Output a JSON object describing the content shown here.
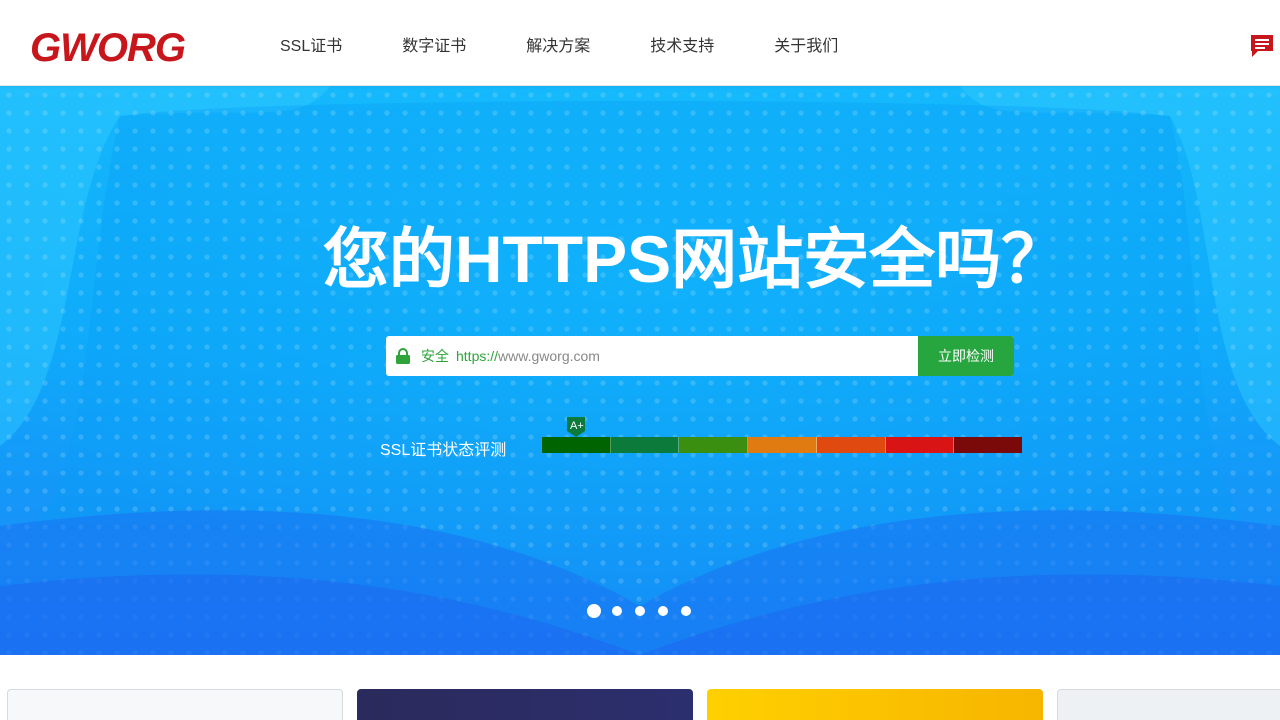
{
  "brand": {
    "logo_text": "GWORG",
    "color": "#c8161d"
  },
  "nav": {
    "items": [
      {
        "label": "SSL证书"
      },
      {
        "label": "数字证书"
      },
      {
        "label": "解决方案"
      },
      {
        "label": "技术支持"
      },
      {
        "label": "关于我们"
      }
    ]
  },
  "header_icon": "chat-icon",
  "hero": {
    "title": "您的HTTPS网站安全吗？",
    "search": {
      "secure_label": "安全",
      "url_prefix": "https://",
      "placeholder": "www.gworg.com",
      "button_label": "立即检测"
    },
    "rating": {
      "label": "SSL证书状态评测",
      "marker_grade": "A+",
      "segment_colors": [
        "#006400",
        "#0b7a3a",
        "#3a8f10",
        "#e07b12",
        "#e04a10",
        "#d81414",
        "#7a0a0a"
      ]
    },
    "carousel": {
      "slide_count": 5,
      "active_index": 0
    }
  },
  "colors": {
    "accent_green": "#27a53e",
    "hero_blue": "#0ea7fa"
  }
}
